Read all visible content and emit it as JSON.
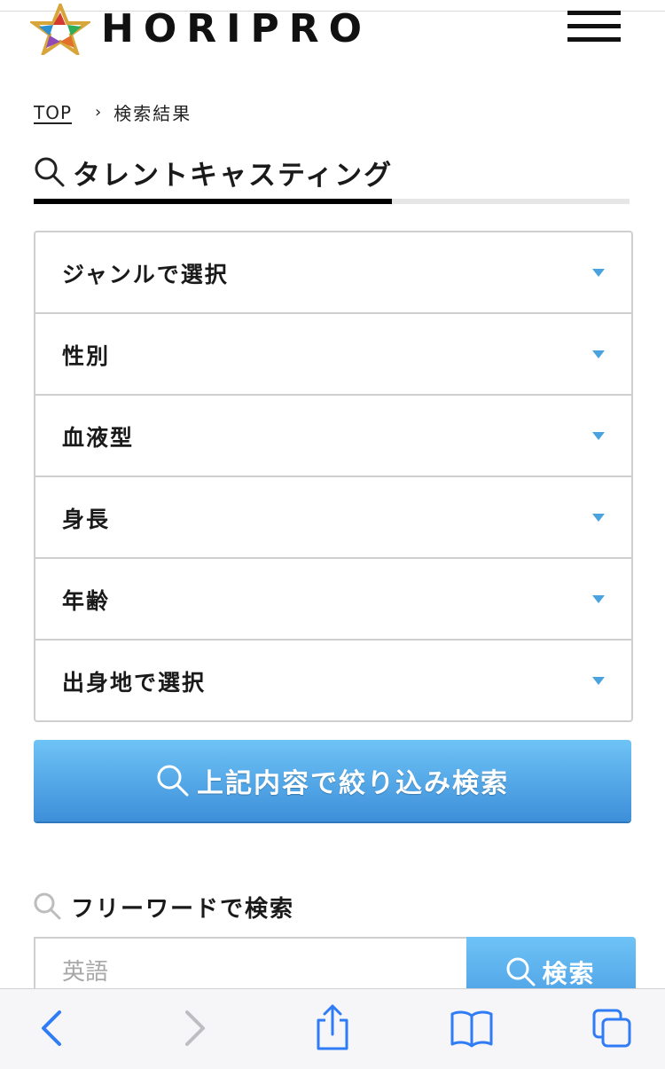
{
  "header": {
    "logo_text": "HORIPRO",
    "menu_icon": "hamburger-menu-icon"
  },
  "breadcrumb": {
    "home": "TOP",
    "separator": "›",
    "current": "検索結果"
  },
  "section": {
    "title": "タレントキャスティング"
  },
  "filters": [
    {
      "label": "ジャンルで選択"
    },
    {
      "label": "性別"
    },
    {
      "label": "血液型"
    },
    {
      "label": "身長"
    },
    {
      "label": "年齢"
    },
    {
      "label": "出身地で選択"
    }
  ],
  "search_button": {
    "label": "上記内容で絞り込み検索"
  },
  "freeword": {
    "title": "フリーワードで検索",
    "placeholder": "英語",
    "button_label": "検索"
  },
  "colors": {
    "accent_blue": "#4aa3df",
    "button_gradient_top": "#6ec3f6",
    "button_gradient_bottom": "#3d8fd9",
    "safari_blue": "#2f7cf6"
  },
  "browser_toolbar": {
    "icons": [
      "back-icon",
      "forward-icon",
      "share-icon",
      "bookmarks-icon",
      "tabs-icon"
    ]
  }
}
